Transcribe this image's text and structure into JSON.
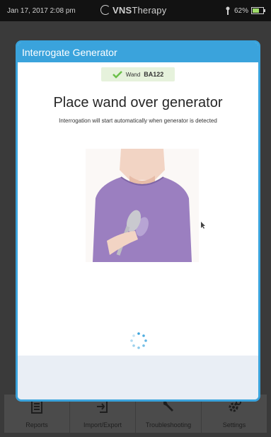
{
  "status_bar": {
    "time": "Jan 17, 2017   2:08 pm",
    "logo_bold": "VNS",
    "logo_thin": "Therapy",
    "battery": "62%"
  },
  "dialog": {
    "header": "Interrogate Generator",
    "wand_prefix": "Wand",
    "wand_id": "BA122",
    "title": "Place wand over generator",
    "subtitle": "Interrogation will start automatically when generator is detected"
  },
  "toolbar": {
    "items": [
      {
        "label": "Reports",
        "icon": "reports-icon"
      },
      {
        "label": "Import/Export",
        "icon": "import-export-icon"
      },
      {
        "label": "Troubleshooting",
        "icon": "wrench-icon"
      },
      {
        "label": "Settings",
        "icon": "gear-icon"
      }
    ]
  },
  "colors": {
    "accent": "#3aa3dc",
    "badge_bg": "#e6f2dc",
    "check": "#6cc04a",
    "shirt": "#9b7fc0"
  }
}
